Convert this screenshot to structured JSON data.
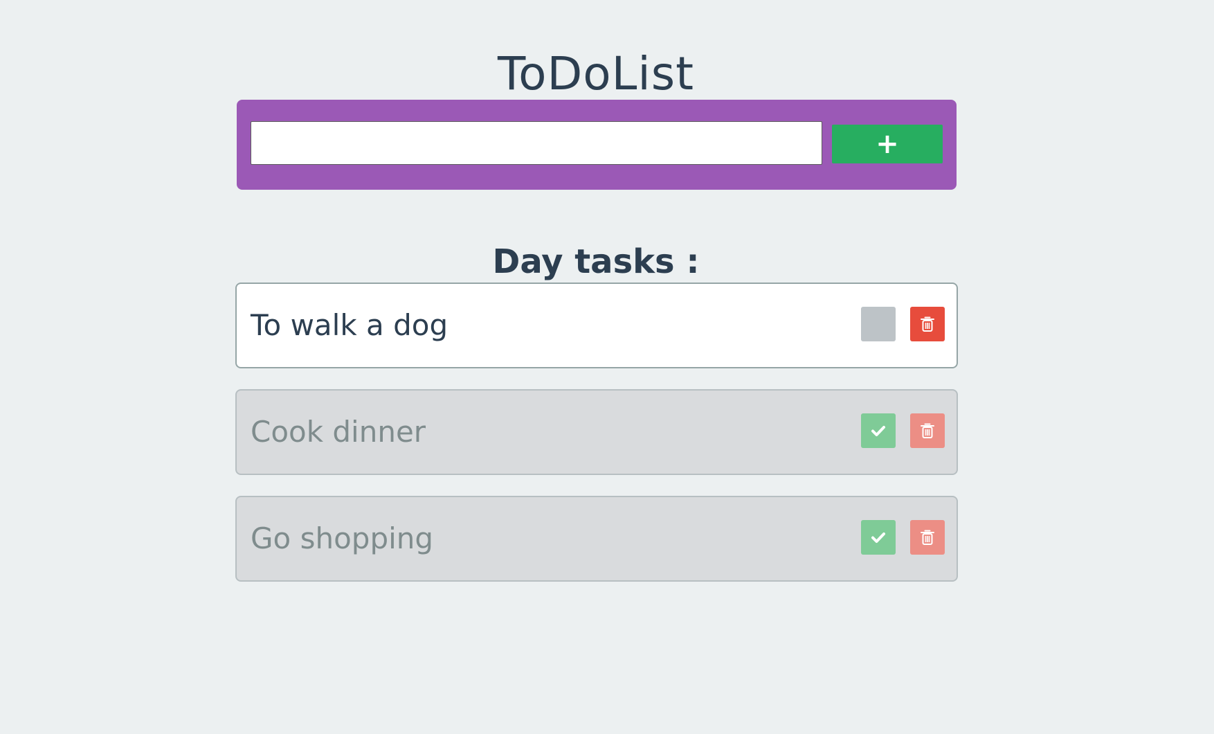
{
  "header": {
    "title": "ToDoList"
  },
  "add_form": {
    "input_value": "",
    "input_placeholder": "",
    "add_button_label": "+"
  },
  "tasks_section": {
    "title": "Day tasks :"
  },
  "tasks": [
    {
      "text": "To walk a dog",
      "completed": false
    },
    {
      "text": "Cook dinner",
      "completed": true
    },
    {
      "text": "Go shopping",
      "completed": true
    }
  ],
  "icons": {
    "check": "check-icon",
    "delete": "trash-icon"
  },
  "colors": {
    "background": "#ecf0f1",
    "panel": "#9b59b6",
    "add_button": "#27ae60",
    "check_unchecked": "#bdc3c7",
    "check_completed": "#7fcb97",
    "delete": "#e74c3c",
    "delete_faded": "#ec8e85",
    "text": "#2c3e50"
  }
}
